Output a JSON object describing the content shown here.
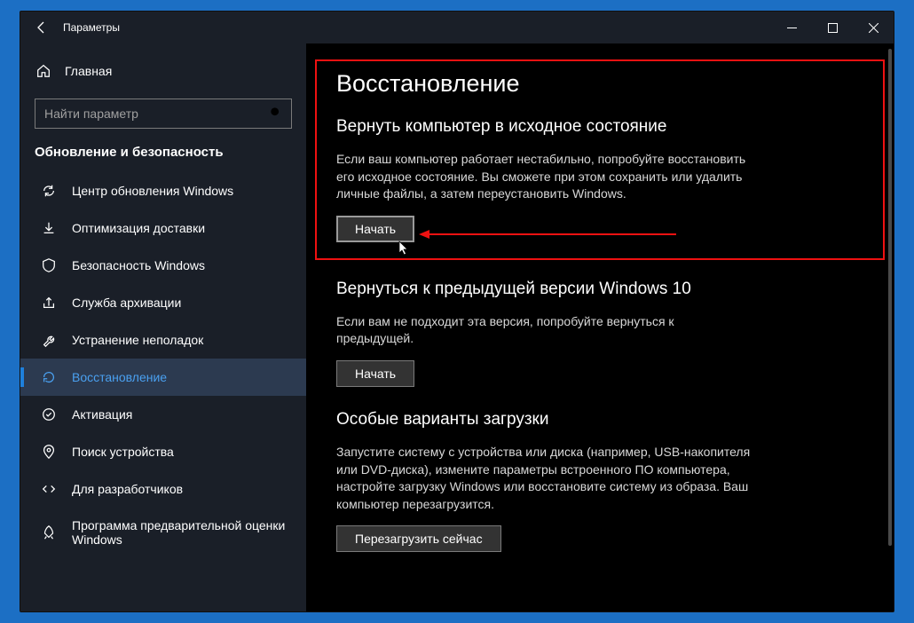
{
  "titlebar": {
    "title": "Параметры"
  },
  "sidebar": {
    "home": "Главная",
    "search_placeholder": "Найти параметр",
    "section": "Обновление и безопасность",
    "items": [
      {
        "label": "Центр обновления Windows"
      },
      {
        "label": "Оптимизация доставки"
      },
      {
        "label": "Безопасность Windows"
      },
      {
        "label": "Служба архивации"
      },
      {
        "label": "Устранение неполадок"
      },
      {
        "label": "Восстановление"
      },
      {
        "label": "Активация"
      },
      {
        "label": "Поиск устройства"
      },
      {
        "label": "Для разработчиков"
      },
      {
        "label": "Программа предварительной оценки Windows"
      }
    ]
  },
  "main": {
    "heading": "Восстановление",
    "reset": {
      "title": "Вернуть компьютер в исходное состояние",
      "body": "Если ваш компьютер работает нестабильно, попробуйте восстановить его исходное состояние. Вы сможете при этом сохранить или удалить личные файлы, а затем переустановить Windows.",
      "button": "Начать"
    },
    "goback": {
      "title": "Вернуться к предыдущей версии Windows 10",
      "body": "Если вам не подходит эта версия, попробуйте вернуться к предыдущей.",
      "button": "Начать"
    },
    "advanced": {
      "title": "Особые варианты загрузки",
      "body": "Запустите систему с устройства или диска (например, USB-накопителя или DVD-диска), измените параметры встроенного ПО компьютера, настройте загрузку Windows или восстановите систему из образа. Ваш компьютер перезагрузится.",
      "button": "Перезагрузить сейчас"
    }
  }
}
